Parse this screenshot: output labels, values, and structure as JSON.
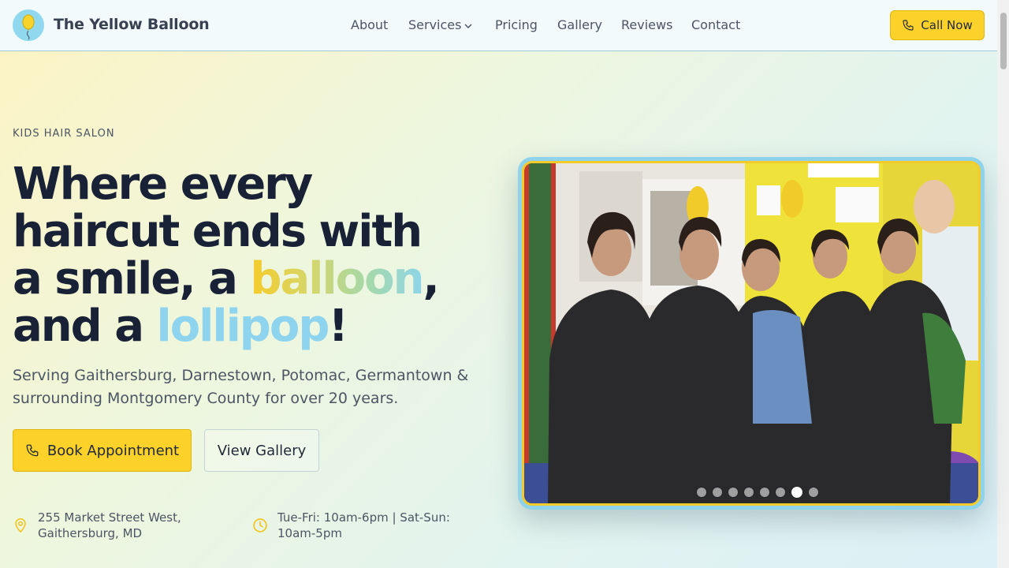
{
  "brand": {
    "name": "The Yellow Balloon",
    "logo_icon": "balloon-icon"
  },
  "nav": {
    "items": [
      {
        "label": "About"
      },
      {
        "label": "Services",
        "has_dropdown": true
      },
      {
        "label": "Pricing"
      },
      {
        "label": "Gallery"
      },
      {
        "label": "Reviews"
      },
      {
        "label": "Contact"
      }
    ],
    "call_button": "Call Now"
  },
  "hero": {
    "eyebrow": "KIDS HAIR SALON",
    "headline": {
      "line1": "Where every",
      "line2": "haircut ends with",
      "line3_start": "a smile, a ",
      "highlight1": "balloon",
      "line3_end": ",",
      "line4_start": "and a ",
      "highlight2": "lollipop",
      "line4_end": "!"
    },
    "subtext": "Serving Gaithersburg, Darnestown, Potomac, Germantown & surrounding Montgomery County for over 20 years.",
    "primary_button": "Book Appointment",
    "secondary_button": "View Gallery",
    "address": "255 Market Street West, Gaithersburg, MD",
    "hours": "Tue-Fri: 10am-6pm | Sat-Sun: 10am-5pm"
  },
  "carousel": {
    "slide_count": 8,
    "active_index": 6
  },
  "colors": {
    "accent_yellow": "#fcd12a",
    "accent_blue": "#8fd4ee",
    "headline_dark": "#182135",
    "body_text": "#4b5563"
  }
}
